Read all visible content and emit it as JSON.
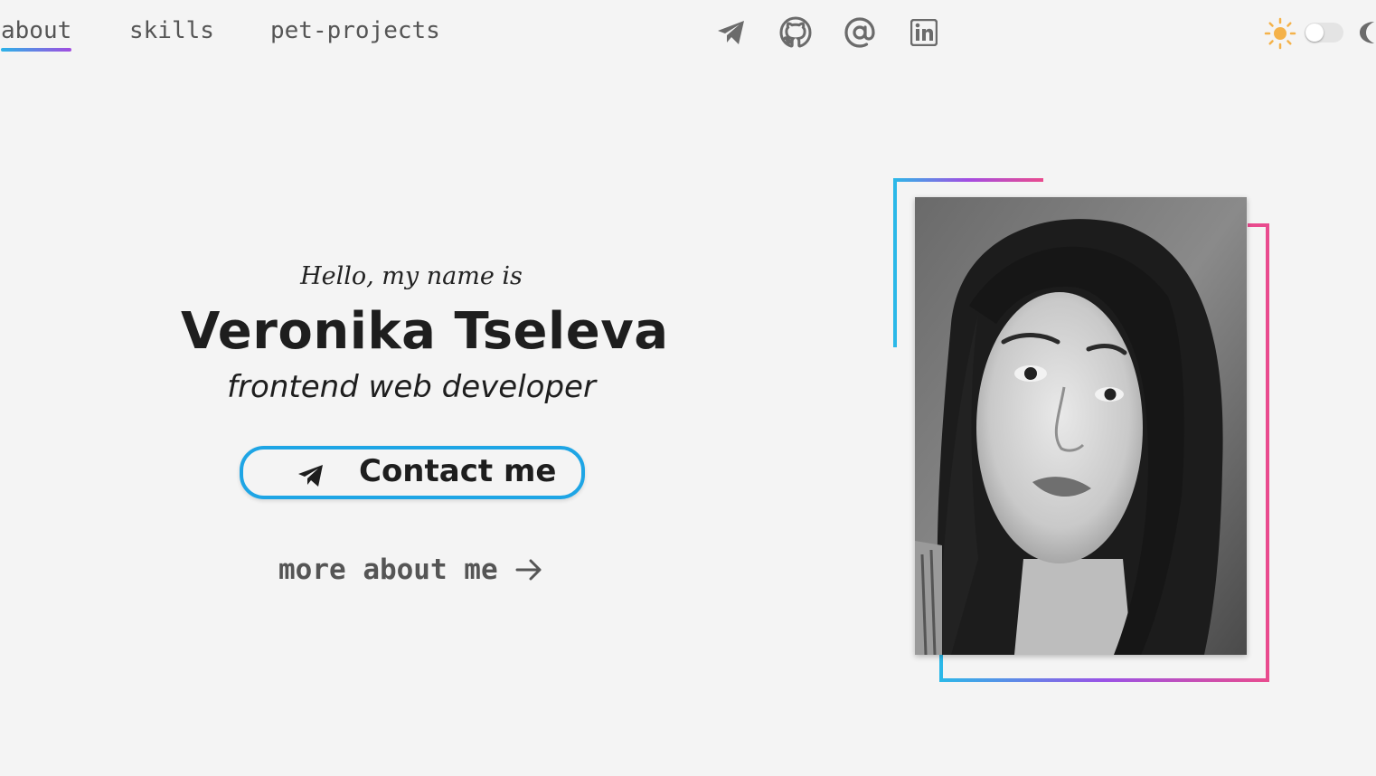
{
  "nav": {
    "links": [
      {
        "label": "about",
        "active": true
      },
      {
        "label": "skills",
        "active": false
      },
      {
        "label": "pet-projects",
        "active": false
      }
    ],
    "accent_gradient": [
      "#2bb3e8",
      "#a24ce0"
    ]
  },
  "social": {
    "icons": [
      "telegram-icon",
      "github-icon",
      "email-at-icon",
      "linkedin-icon"
    ],
    "icon_color": "#6b6b6b"
  },
  "theme": {
    "sun_color": "#f4b24a",
    "mode": "light"
  },
  "hero": {
    "greeting": "Hello, my name is",
    "name": "Veronika Tseleva",
    "role": "frontend web developer",
    "contact_label": "Contact me",
    "more_label": "more about me",
    "button_border_color": "#1ea5e5"
  },
  "photo": {
    "frame_colors": [
      "#2bb8e8",
      "#a44ce2",
      "#e94b8e"
    ]
  }
}
